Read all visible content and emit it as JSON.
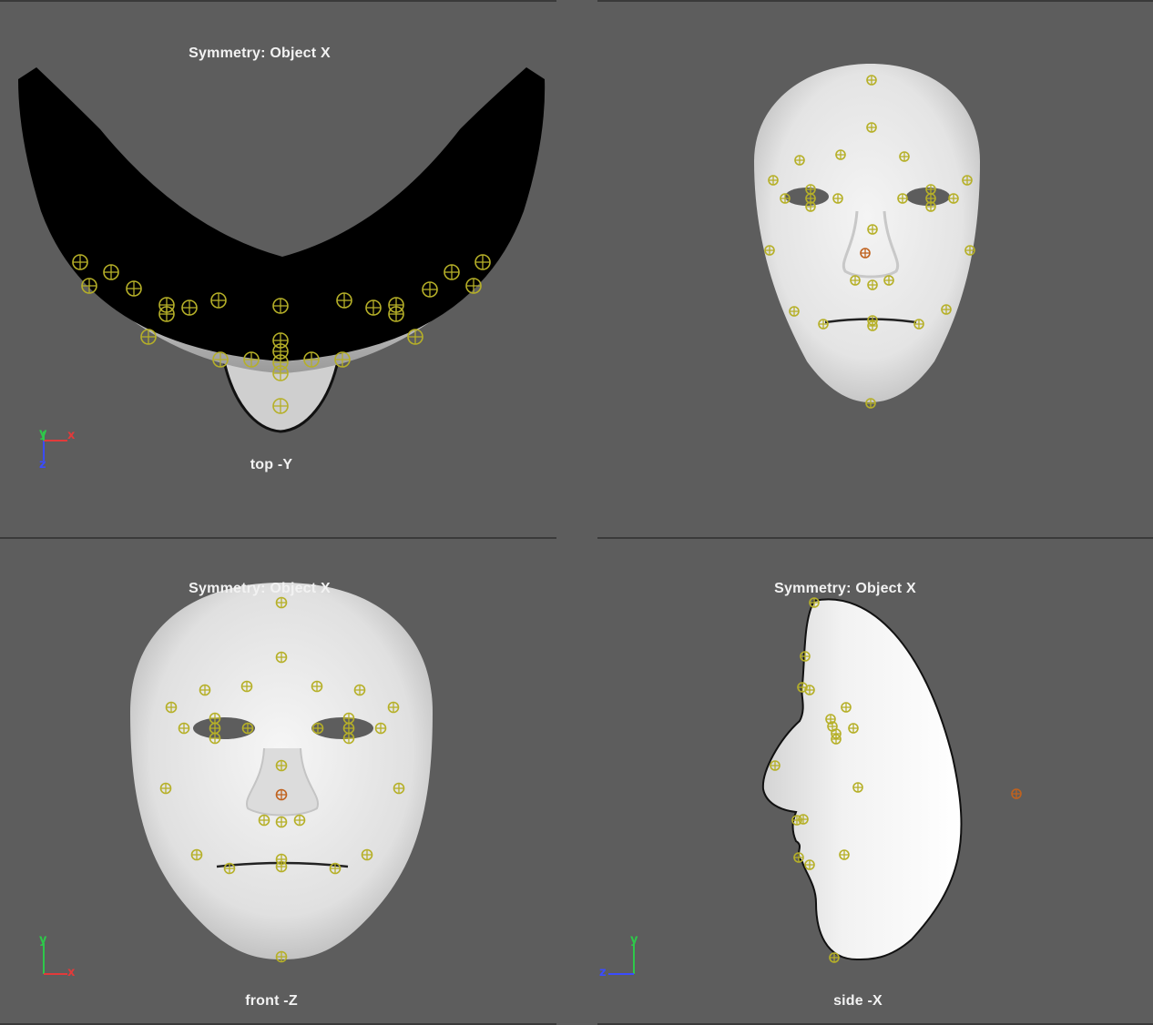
{
  "viewports": {
    "top": {
      "symmetry": "Symmetry: Object X",
      "camera": "top -Y"
    },
    "persp": {
      "symmetry": "",
      "camera": ""
    },
    "front": {
      "symmetry": "Symmetry: Object X",
      "camera": "front -Z"
    },
    "side": {
      "symmetry": "Symmetry: Object X",
      "camera": "side -X"
    }
  },
  "axes": {
    "top": [
      "y",
      "x",
      "z"
    ],
    "front": [
      "y",
      "x"
    ],
    "side": [
      "y",
      "z"
    ]
  },
  "colors": {
    "viewport_bg": "#5d5d5d",
    "locator": "#b6b028",
    "locator_selected": "#c0621e",
    "axis_x": "#e23a3a",
    "axis_y": "#2ec84a",
    "axis_z": "#3a4cff"
  },
  "icons": {
    "locator": "crosshair-circle-icon"
  }
}
